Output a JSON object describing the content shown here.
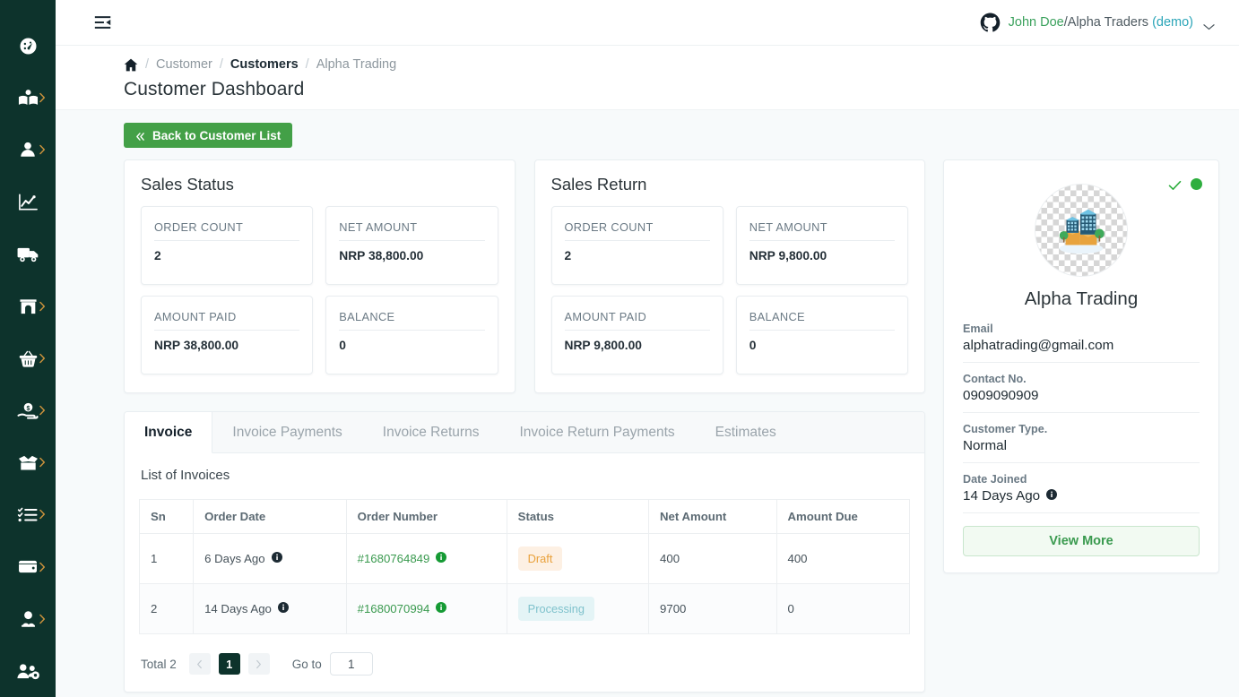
{
  "sidebar": {
    "items": [
      {
        "name": "dashboard",
        "icon": "gauge-icon",
        "chevron": false
      },
      {
        "name": "catalog",
        "icon": "open-book-icon",
        "chevron": true
      },
      {
        "name": "customer",
        "icon": "user-icon",
        "chevron": true
      },
      {
        "name": "reports",
        "icon": "line-chart-icon",
        "chevron": false
      },
      {
        "name": "delivery",
        "icon": "truck-icon",
        "chevron": false
      },
      {
        "name": "store",
        "icon": "storefront-icon",
        "chevron": true
      },
      {
        "name": "purchase",
        "icon": "basket-icon",
        "chevron": true
      },
      {
        "name": "expense",
        "icon": "hand-dollar-icon",
        "chevron": true
      },
      {
        "name": "inventory",
        "icon": "open-box-icon",
        "chevron": true
      },
      {
        "name": "tasks",
        "icon": "checklist-icon",
        "chevron": true
      },
      {
        "name": "accounts",
        "icon": "wallet-icon",
        "chevron": true
      },
      {
        "name": "employees",
        "icon": "people-icon",
        "chevron": true
      },
      {
        "name": "user-management",
        "icon": "users-gear-icon",
        "chevron": false
      }
    ]
  },
  "topbar": {
    "collapse_icon": "sidebar-collapse-icon",
    "brand_icon": "github-icon",
    "user_name": "John Doe",
    "separator": "/",
    "org_name": "Alpha Traders",
    "env_label": "(demo)",
    "caret_icon": "chevron-down-icon"
  },
  "breadcrumb": {
    "home_icon": "home-icon",
    "items": [
      "Customer",
      "Customers",
      "Alpha Trading"
    ],
    "separator": "/"
  },
  "page": {
    "title": "Customer Dashboard",
    "back_button": "Back to Customer List"
  },
  "sales_status": {
    "title": "Sales Status",
    "stats": [
      {
        "label": "ORDER COUNT",
        "value": "2"
      },
      {
        "label": "NET AMOUNT",
        "value": "NRP 38,800.00"
      },
      {
        "label": "AMOUNT PAID",
        "value": "NRP 38,800.00"
      },
      {
        "label": "BALANCE",
        "value": "0"
      }
    ]
  },
  "sales_return": {
    "title": "Sales Return",
    "stats": [
      {
        "label": "ORDER COUNT",
        "value": "2"
      },
      {
        "label": "NET AMOUNT",
        "value": "NRP 9,800.00"
      },
      {
        "label": "AMOUNT PAID",
        "value": "NRP 9,800.00"
      },
      {
        "label": "BALANCE",
        "value": "0"
      }
    ]
  },
  "tabs": {
    "items": [
      {
        "label": "Invoice",
        "active": true
      },
      {
        "label": "Invoice Payments",
        "active": false
      },
      {
        "label": "Invoice Returns",
        "active": false
      },
      {
        "label": "Invoice Return Payments",
        "active": false
      },
      {
        "label": "Estimates",
        "active": false
      }
    ]
  },
  "invoice_table": {
    "caption": "List of Invoices",
    "columns": [
      "Sn",
      "Order Date",
      "Order Number",
      "Status",
      "Net Amount",
      "Amount Due"
    ],
    "rows": [
      {
        "sn": "1",
        "order_date": "6 Days Ago",
        "order_number": "#1680764849",
        "status": "Draft",
        "status_kind": "draft",
        "net_amount": "400",
        "amount_due": "400"
      },
      {
        "sn": "2",
        "order_date": "14 Days Ago",
        "order_number": "#1680070994",
        "status": "Processing",
        "status_kind": "processing",
        "net_amount": "9700",
        "amount_due": "0"
      }
    ]
  },
  "pagination": {
    "total_label": "Total 2",
    "prev_icon": "chevron-left-icon",
    "next_icon": "chevron-right-icon",
    "current_page": "1",
    "goto_label": "Go to",
    "goto_value": "1"
  },
  "profile": {
    "verified_icon": "check-icon",
    "status_dot": "online-status-dot",
    "avatar_icon": "office-building-icon",
    "name": "Alpha Trading",
    "fields": [
      {
        "label": "Email",
        "value": "alphatrading@gmail.com",
        "info": false
      },
      {
        "label": "Contact No.",
        "value": "0909090909",
        "info": false
      },
      {
        "label": "Customer Type.",
        "value": "Normal",
        "info": false
      },
      {
        "label": "Date Joined",
        "value": "14 Days Ago",
        "info": true
      }
    ],
    "view_more": "View More"
  },
  "colors": {
    "rail_bg": "#0d332c",
    "page_bg": "#f7fafb",
    "accent_green": "#43a047",
    "link_green": "#3a9a4f",
    "user_name_green": "#3aa15c",
    "demo_teal": "#2ba5b8",
    "badge_draft_bg": "#fdf0e3",
    "badge_draft_fg": "#e9a13b",
    "badge_processing_bg": "#e4f4f6",
    "badge_processing_fg": "#7fc2cc",
    "status_dot": "#2eae3e"
  }
}
